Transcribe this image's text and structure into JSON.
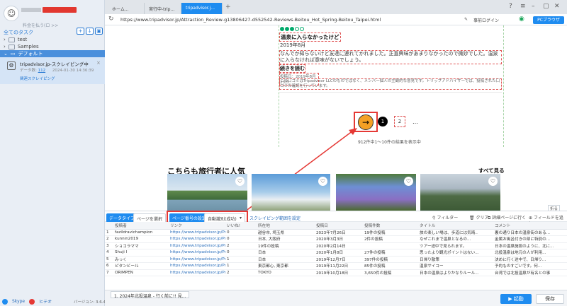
{
  "sidebar": {
    "subtitle": "料金を払う(ロ >>",
    "all_tasks": "全てのタスク",
    "folders": [
      "test",
      "Samples"
    ],
    "default_folder": "デフォルト",
    "task": {
      "name": "tripadvisor.jp-スクレイピング中",
      "meta_label": "データ数:",
      "meta_count": "112",
      "meta_date": "2024-01-30 14:36:39",
      "link": "関連スクレイピング"
    },
    "footer": {
      "skype": "Skype",
      "email": "ヒテオ",
      "version": "バージョン: 3.6.4"
    }
  },
  "tabs": [
    {
      "label": "ホーム...",
      "active": false
    },
    {
      "label": "実行中-trip...",
      "active": false
    },
    {
      "label": "tripadvisor.j...",
      "active": true
    }
  ],
  "address": {
    "url": "https://www.tripadvisor.jp/Attraction_Review-g13806427-d552542-Reviews-Beitou_Hot_Spring-Beitou_Taipei.html",
    "login": "事前ログイン",
    "browser_button": "PCブラウザ"
  },
  "review": {
    "title": "温泉に入らなかったけど",
    "date": "2019年8月",
    "body": "なんでか知らないけど友達に連れてかれました。正直興味があまりなかったので微妙でした。温泉に入らなければ意味がないでしょう。",
    "more": "続きを読む",
    "posted": "投稿日：2019年8月23日",
    "disclaimer": "この口コミはTripadvisor LLCのものではなく、メンバー個人の主観的な意見です。トリップアドバイザーでは、投稿された口コミの確認を行っています。",
    "pagination": [
      "1",
      "2",
      "…"
    ],
    "results": "912件中1～10件の結果を表示中"
  },
  "section": {
    "title": "こちらも旅行者に人気",
    "see_all": "すべて見る"
  },
  "toolbar": {
    "data_type": "データタイプ",
    "page_select": "ページを選択",
    "page_type_label": "ページ番号の設定",
    "page_type_value": "自動識別(成功)",
    "scroll_setting": "スクレイピング範囲を設定",
    "filter": "フィルター",
    "clear": "クリア",
    "detail": "詳細ページに行く",
    "add_field": "フィールドを追加",
    "collapse": "折る"
  },
  "table": {
    "columns": [
      "",
      "投稿者",
      "リンク",
      "いいね!",
      "所在地",
      "投稿日",
      "投稿件数",
      "タイトル",
      "コメント"
    ],
    "rows": [
      [
        "1",
        "fazildravichampion",
        "https://www.tripadvisor.jp/Profil...",
        "0",
        "越谷市, 埼玉県",
        "2023年7月26日",
        "19件の投稿",
        "旅の楽しい場は、歩道には気晴..",
        "裏の通り日本の温泉街のある..."
      ],
      [
        "2",
        "kunnin2019",
        "https://www.tripadvisor.jp/Profil...",
        "0",
        "日本, 大阪府",
        "2020年3月3日",
        "2件の投稿",
        "なぜこれまで温泉となるの...",
        "金属お風呂付きの部に特別の..."
      ],
      [
        "3",
        "ショコラママ",
        "https://www.tripadvisor.jp/Profil...",
        "2",
        "19件の投稿",
        "2020年2月14日",
        "",
        "ツアー途中で見られます。",
        "日本の温泉施設のように、北に..."
      ],
      [
        "4",
        "Shuji I",
        "https://www.tripadvisor.jp/Profil...",
        "0",
        "日本",
        "2020年1月8日",
        "27件の投稿",
        "思ったより観光ポイントはない...",
        "北投温泉は地元の人が利用..."
      ],
      [
        "5",
        "みっく",
        "https://www.tripadvisor.jp/Profil...",
        "1",
        "日本",
        "2019年12月7日",
        "397件の投稿",
        "日帰り散策",
        "決めに行く途中で、日帰り..."
      ],
      [
        "6",
        "ピタンビール",
        "https://www.tripadvisor.jp/Profil...",
        "1",
        "東京都心, 東京都",
        "2019年11月22日",
        "85件の投稿",
        "温泉サイコー",
        "予約ものすごいです。何..."
      ],
      [
        "7",
        "ORIMPEN",
        "https://www.tripadvisor.jp/Profil...",
        "2",
        "TOKYO",
        "2019年10月18日",
        "3,650件の投稿",
        "日本の温泉はよりかなりルール...",
        "台湾では北投温泉が有名との事"
      ]
    ]
  },
  "status": {
    "tab": "1. 2024年北投温泉 - 行く前に!! 見...",
    "run": "起動",
    "save": "保存"
  }
}
